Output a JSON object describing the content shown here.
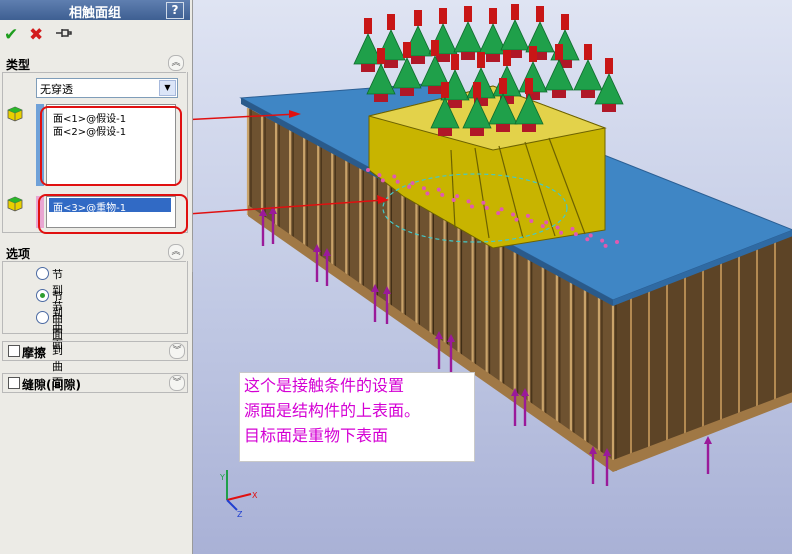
{
  "panel": {
    "title": "相触面组",
    "help_label": "?",
    "type_section": {
      "label": "类型",
      "dropdown_value": "无穿透"
    },
    "source_faces": [
      "面<1>@假设-1",
      "面<2>@假设-1"
    ],
    "target_faces": [
      "面<3>@重物-1"
    ],
    "options_section": {
      "label": "选项",
      "radios": [
        {
          "label": "节到节",
          "selected": false
        },
        {
          "label": "节到曲面",
          "selected": true
        },
        {
          "label": "曲面到曲面",
          "selected": false
        }
      ]
    },
    "friction_label": "摩擦",
    "gap_label": "缝隙(间隙)"
  },
  "annotation": {
    "lines": [
      "这个是接触条件的设置",
      "源面是结构件的上表面。",
      "目标面是重物下表面"
    ]
  },
  "triad": {
    "x_label": "X",
    "y_label": "Y",
    "z_label": "Z"
  },
  "colors": {
    "title_bar": "#3e5f92",
    "annotation_text": "#d400d4",
    "callout_red": "#e01010",
    "deck_blue": "#3f86c5",
    "rib_brown": "#7a5a32",
    "load_green": "#1fa04a",
    "load_red": "#c81616",
    "support_purple": "#9a1a9a",
    "yellow_body": "#c8b400"
  },
  "icons": [
    "check-icon",
    "close-icon",
    "pushpin-icon",
    "cube-icon",
    "chevron-up-icon",
    "chevron-down-icon"
  ]
}
